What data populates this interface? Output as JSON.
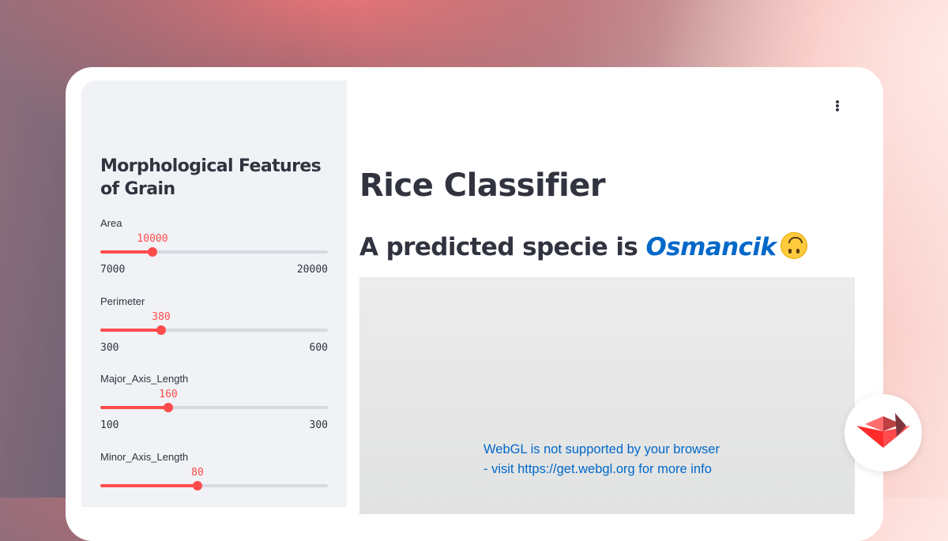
{
  "sidebar": {
    "title": "Morphological Features of Grain",
    "sliders": [
      {
        "label": "Area",
        "value": "10000",
        "min": "7000",
        "max": "20000",
        "fraction": 0.2308
      },
      {
        "label": "Perimeter",
        "value": "380",
        "min": "300",
        "max": "600",
        "fraction": 0.2667
      },
      {
        "label": "Major_Axis_Length",
        "value": "160",
        "min": "100",
        "max": "300",
        "fraction": 0.3
      },
      {
        "label": "Minor_Axis_Length",
        "value": "80",
        "fraction": 0.43
      }
    ]
  },
  "main": {
    "title": "Rice Classifier",
    "prediction_prefix": "A predicted specie is ",
    "prediction_species": "Osmancik",
    "prediction_emoji": "upside-down-face-emoji",
    "webgl_line1": "WebGL is not supported by your browser",
    "webgl_line2": "- visit https://get.webgl.org for more info"
  },
  "icons": {
    "menu": "vertical-ellipsis-icon",
    "badge": "streamlit-logo-icon"
  },
  "colors": {
    "accent": "#ff4b4b",
    "link": "#0068c9",
    "text": "#31333f",
    "sidebar_bg": "#f0f2f6"
  }
}
